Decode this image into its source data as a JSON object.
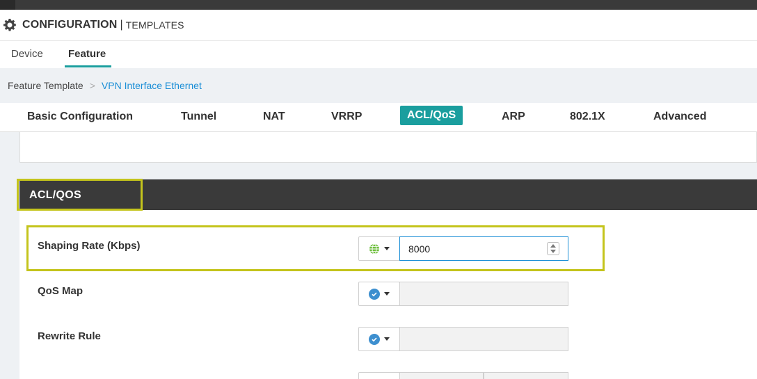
{
  "header": {
    "title": "CONFIGURATION",
    "separator": "|",
    "subtitle": "TEMPLATES"
  },
  "subtabs": [
    {
      "label": "Device",
      "active": false
    },
    {
      "label": "Feature",
      "active": true
    }
  ],
  "breadcrumb": {
    "root": "Feature Template",
    "separator": ">",
    "current": "VPN Interface Ethernet"
  },
  "section_tabs": [
    {
      "label": "Basic Configuration",
      "active": false
    },
    {
      "label": "Tunnel",
      "active": false
    },
    {
      "label": "NAT",
      "active": false
    },
    {
      "label": "VRRP",
      "active": false
    },
    {
      "label": "ACL/QoS",
      "active": true
    },
    {
      "label": "ARP",
      "active": false
    },
    {
      "label": "802.1X",
      "active": false
    },
    {
      "label": "Advanced",
      "active": false
    }
  ],
  "section": {
    "title": "ACL/QOS"
  },
  "fields": [
    {
      "label": "Shaping Rate (Kbps)",
      "scope_icon": "globe-icon",
      "value": "8000"
    },
    {
      "label": "QoS Map",
      "scope_icon": "check-circle-icon",
      "value": ""
    },
    {
      "label": "Rewrite Rule",
      "scope_icon": "check-circle-icon",
      "value": ""
    }
  ],
  "colors": {
    "accent": "#1a9e9e",
    "link": "#1a8ed6",
    "highlight": "#c4c41c",
    "dark_header": "#3a3a3a",
    "globe": "#6fbf3f",
    "check": "#3d8fcf"
  }
}
